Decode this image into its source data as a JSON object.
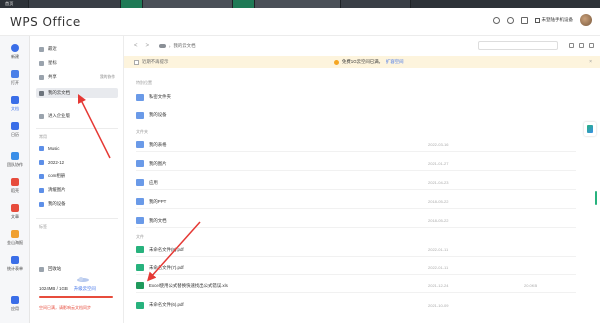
{
  "top_strip": {
    "home_label": "首页"
  },
  "header": {
    "logo": "WPS Office",
    "link_label": "未登陆手机设备"
  },
  "rail": {
    "items": [
      {
        "label": "新建"
      },
      {
        "label": "打开"
      },
      {
        "label": "文档"
      },
      {
        "label": "日历"
      },
      {
        "label": "团队协作"
      },
      {
        "label": "稻壳"
      },
      {
        "label": "文章"
      },
      {
        "label": "金山海报"
      },
      {
        "label": "统计表单"
      },
      {
        "label": "应用"
      }
    ]
  },
  "sidebar": {
    "items": [
      {
        "label": "最近",
        "sub": ""
      },
      {
        "label": "星标",
        "sub": ""
      },
      {
        "label": "共享",
        "sub": "我的协作"
      },
      {
        "label": "我的云文档",
        "sub": ""
      },
      {
        "label": "进入企业版",
        "sub": ""
      }
    ],
    "section_recent": "常用",
    "folders": [
      {
        "label": "Music"
      },
      {
        "label": "2022-12"
      },
      {
        "label": "com相册"
      },
      {
        "label": "清缓图片"
      },
      {
        "label": "我的设备"
      }
    ],
    "section_tags": "标签",
    "recycle": "回收站",
    "storage_used": "1024MB / 1GB",
    "storage_link": "升级云空间",
    "storage_warning": "空间已满，请影响云文档同步"
  },
  "main": {
    "nav": [
      "<",
      ">"
    ],
    "breadcrumb": "我的云文档",
    "search_placeholder": "",
    "banner": {
      "checkbox_label": "近期不再提示",
      "message": "免费1G云空间已满，",
      "link": "扩容空间",
      "close": "×"
    },
    "section_special": "特别位置",
    "special_folders": [
      {
        "name": "私密文件夹"
      },
      {
        "name": "我的设备"
      }
    ],
    "section_folders": "文件夹",
    "folders": [
      {
        "name": "我的表格",
        "date": "2022-03-16"
      },
      {
        "name": "我的图片",
        "date": "2021-01-27"
      },
      {
        "name": "应用",
        "date": "2021-04-23"
      },
      {
        "name": "我的PPT",
        "date": "2018-05-22"
      },
      {
        "name": "我的文档",
        "date": "2018-05-22"
      }
    ],
    "section_files": "文件",
    "files": [
      {
        "name": "未命名文件(8).pdf",
        "date": "2022-01-11",
        "size": "",
        "type": "pdf"
      },
      {
        "name": "未命名文件(7).pdf",
        "date": "2022-01-11",
        "size": "",
        "type": "pdf"
      },
      {
        "name": "Excel使用公式替换快速找出公式错误.xls",
        "date": "2021-12-24",
        "size": "20.0KB",
        "type": "xls"
      },
      {
        "name": "未命名文件(6).pdf",
        "date": "2021-10-09",
        "size": "",
        "type": "pdf"
      }
    ]
  },
  "colors": {
    "accent": "#3a6ee8",
    "warning": "#e74c3c",
    "banner_bg": "#fdf4dd",
    "file_green": "#27b27d"
  }
}
